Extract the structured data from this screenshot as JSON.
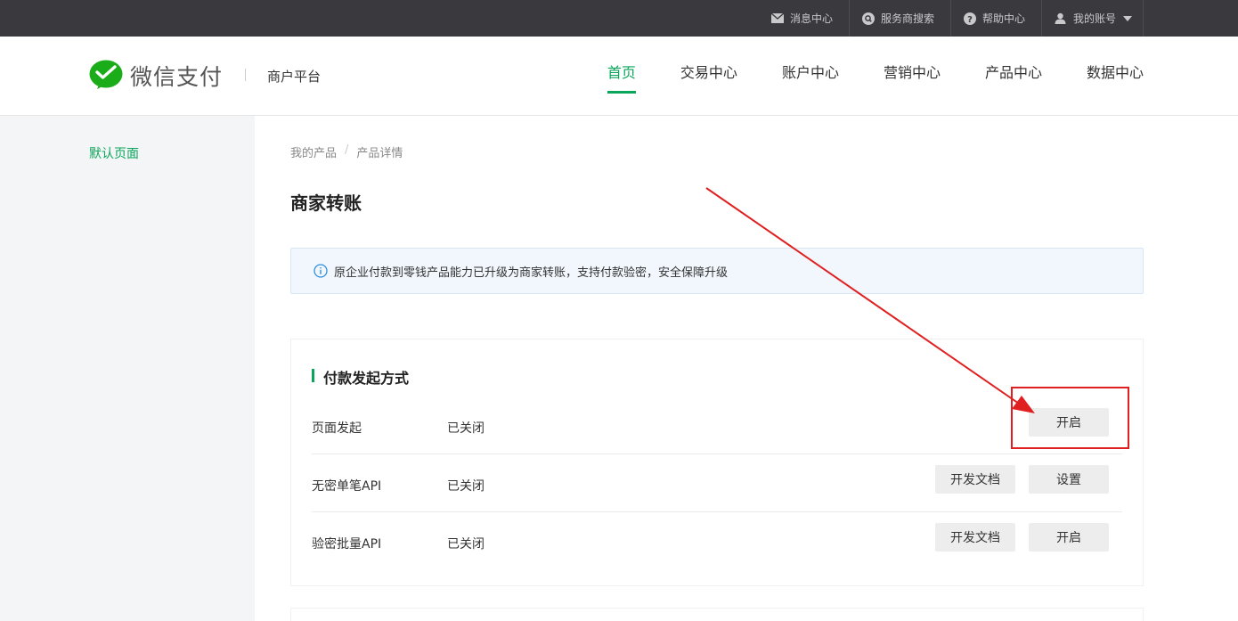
{
  "topbar": {
    "links": [
      {
        "label": "消息中心",
        "icon": "mail-icon"
      },
      {
        "label": "服务商搜索",
        "icon": "search-icon"
      },
      {
        "label": "帮助中心",
        "icon": "help-icon"
      },
      {
        "label": "我的账号",
        "icon": "user-icon"
      }
    ]
  },
  "header": {
    "logo_text": "微信支付",
    "subtitle": "商户平台",
    "nav": [
      "首页",
      "交易中心",
      "账户中心",
      "营销中心",
      "产品中心",
      "数据中心"
    ],
    "active_nav": "首页"
  },
  "sidebar": {
    "items": [
      {
        "label": "默认页面"
      }
    ]
  },
  "breadcrumb": [
    "我的产品",
    "产品详情"
  ],
  "page_title": "商家转账",
  "notice": "原企业付款到零钱产品能力已升级为商家转账，支持付款验密，安全保障升级",
  "section": {
    "title": "付款发起方式",
    "rows": [
      {
        "name": "页面发起",
        "status": "已关闭",
        "doc_button": null,
        "action_button": "开启"
      },
      {
        "name": "无密单笔API",
        "status": "已关闭",
        "doc_button": "开发文档",
        "action_button": "设置"
      },
      {
        "name": "验密批量API",
        "status": "已关闭",
        "doc_button": "开发文档",
        "action_button": "开启"
      }
    ]
  },
  "colors": {
    "accent": "#09a55a",
    "topbar": "#3a3a3e",
    "annotation": "#e02020"
  }
}
